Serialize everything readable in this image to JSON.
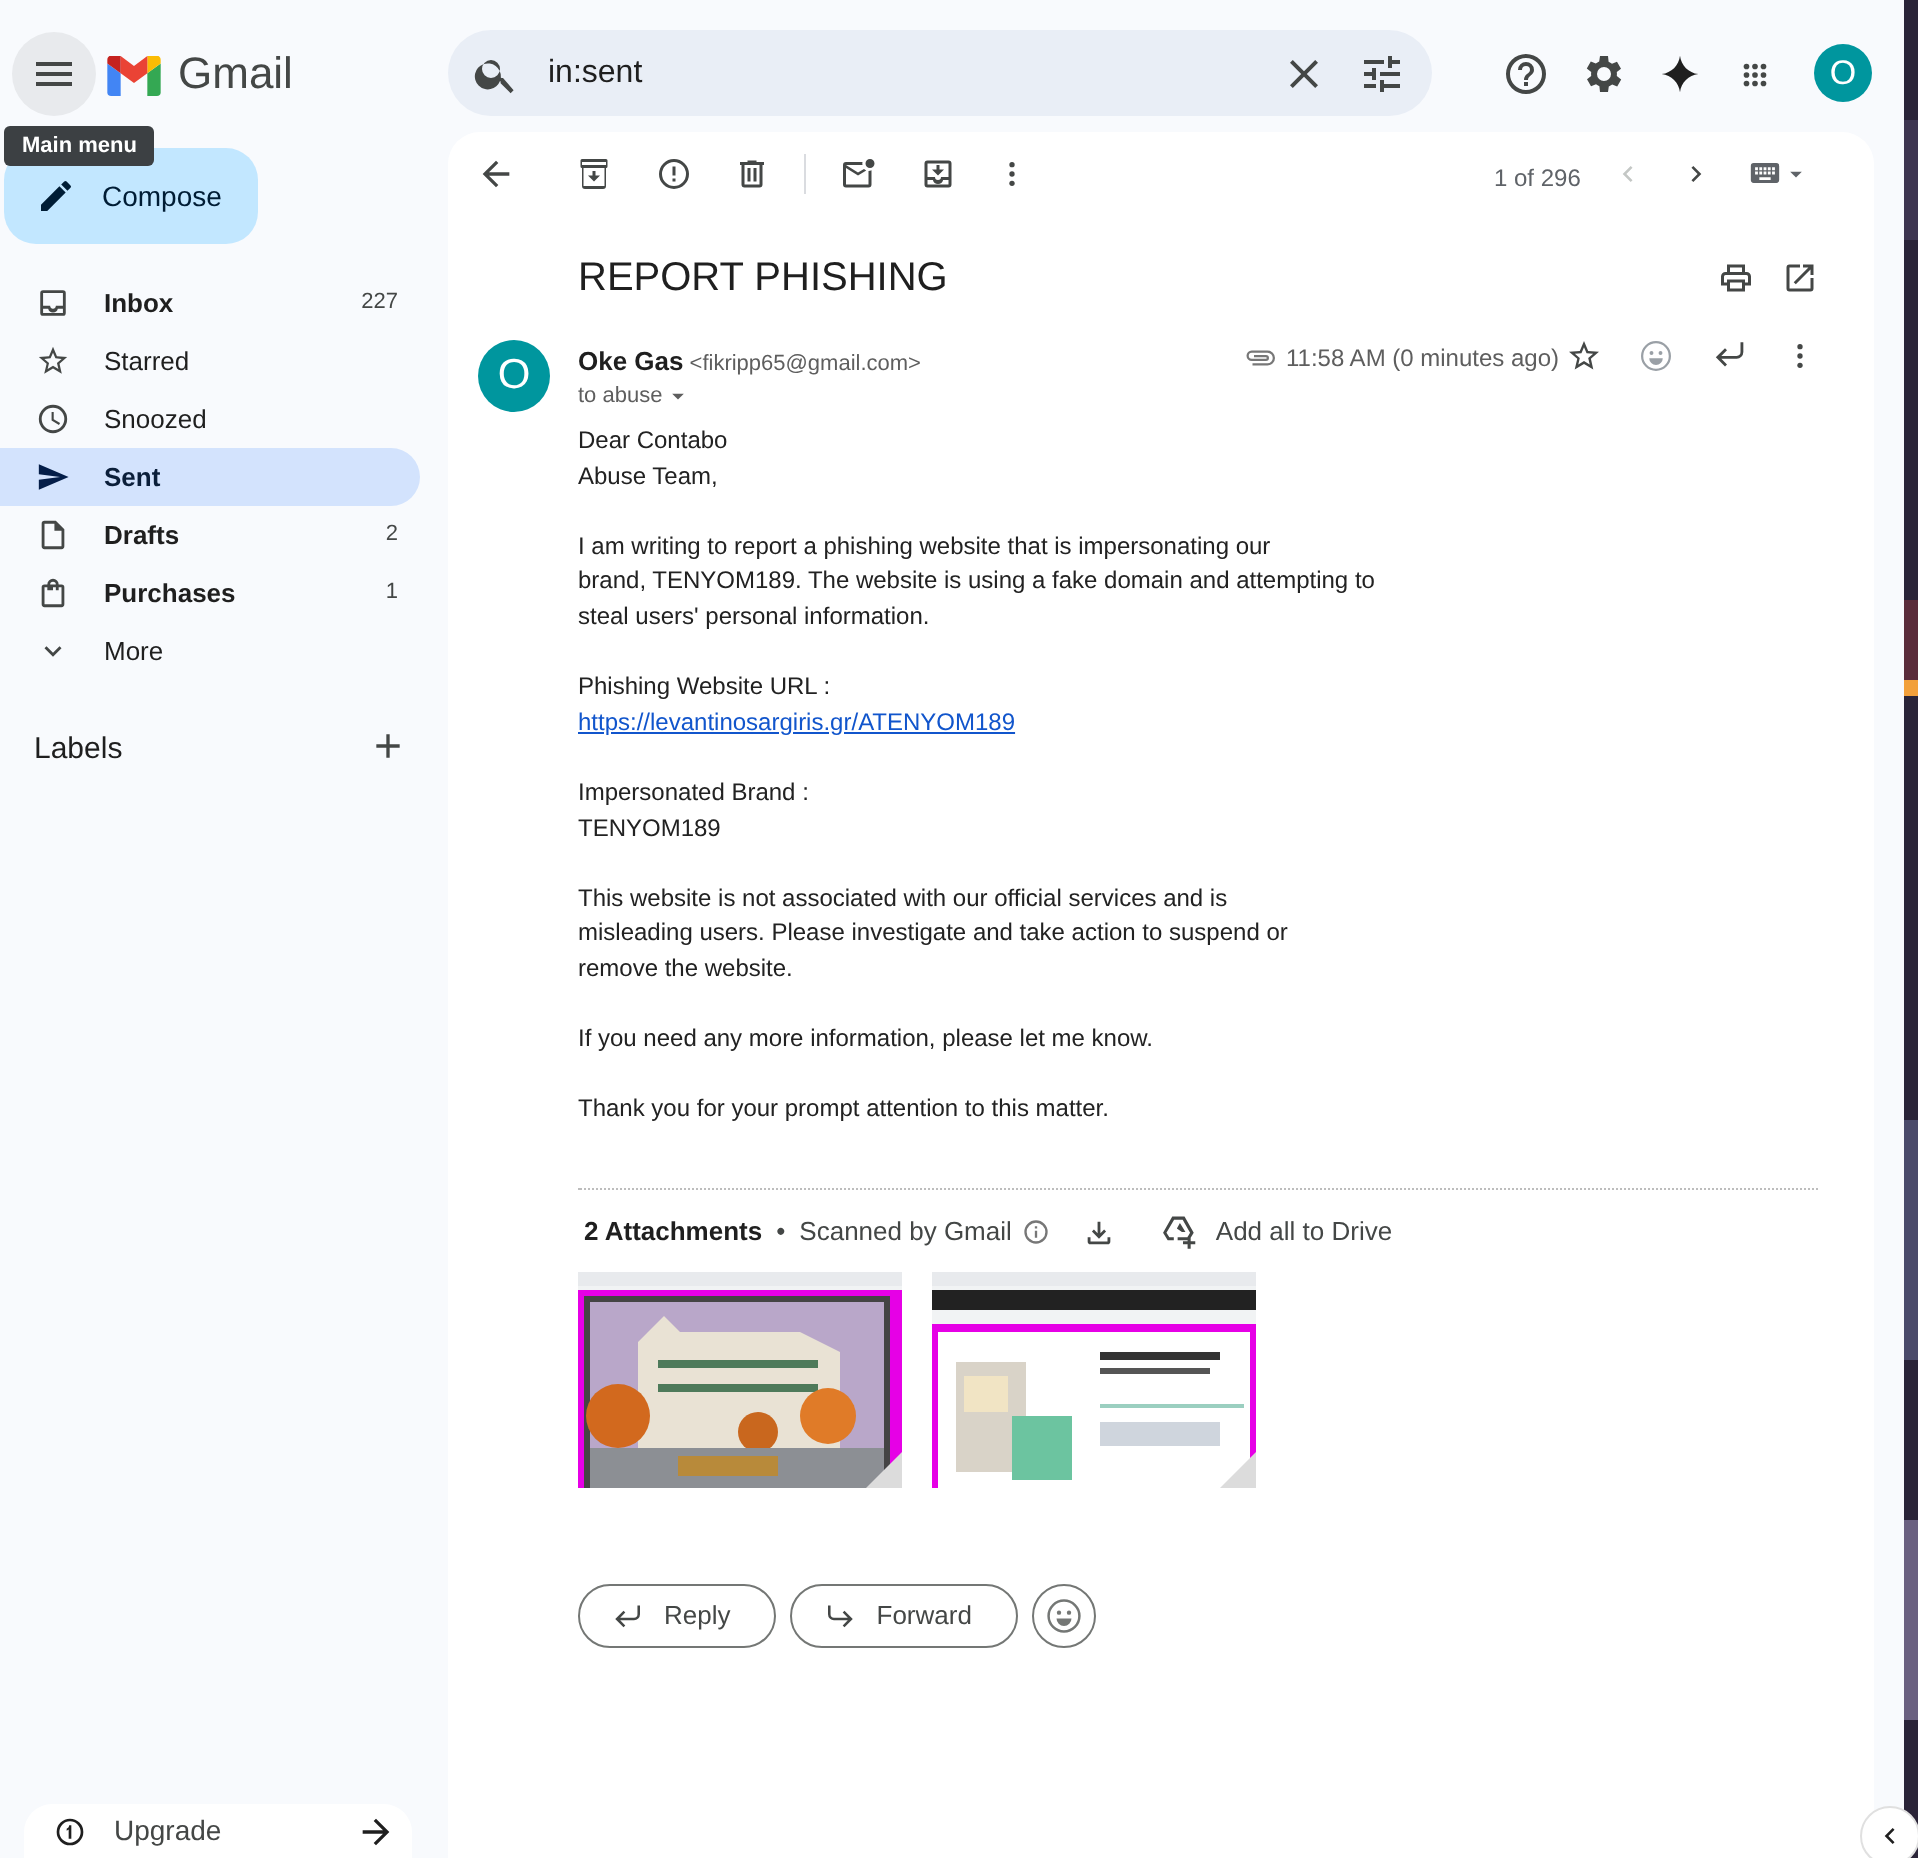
{
  "topbar": {
    "app_name": "Gmail",
    "tooltip": "Main menu",
    "search": {
      "value": "in:sent"
    },
    "avatar": "O"
  },
  "sidebar": {
    "compose": "Compose",
    "items": [
      {
        "label": "Inbox",
        "count": "227",
        "selected": false,
        "unread": true
      },
      {
        "label": "Starred",
        "selected": false,
        "unread": false
      },
      {
        "label": "Snoozed",
        "selected": false,
        "unread": false
      },
      {
        "label": "Sent",
        "selected": true,
        "unread": false
      },
      {
        "label": "Drafts",
        "count": "2",
        "selected": false,
        "unread": true
      },
      {
        "label": "Purchases",
        "count": "1",
        "selected": false,
        "unread": true
      },
      {
        "label": "More",
        "selected": false,
        "unread": false
      }
    ],
    "labels_heading": "Labels",
    "upgrade": "Upgrade"
  },
  "toolbar": {
    "position": "1 of 296",
    "prev_disabled": true
  },
  "email": {
    "subject": "REPORT PHISHING",
    "sender_name": "Oke Gas",
    "sender_email": "<fikripp65@gmail.com>",
    "avatar": "O",
    "recipient": "to abuse",
    "time": "11:58 AM (0 minutes ago)",
    "body": [
      {
        "lines": [
          {
            "kind": "text",
            "text": "Dear Contabo"
          },
          {
            "kind": "text",
            "text": "Abuse Team,"
          }
        ]
      },
      {
        "lines": [
          {
            "kind": "text",
            "text": "I am writing to report a phishing website that is impersonating our"
          },
          {
            "kind": "text",
            "text": "brand, TENYOM189. The website is using a fake domain and attempting to"
          },
          {
            "kind": "text",
            "text": "steal users' personal information."
          }
        ]
      },
      {
        "lines": [
          {
            "kind": "text",
            "text": "Phishing Website URL :"
          },
          {
            "kind": "link",
            "text": "https://levantinosargiris.gr/ATENYOM189"
          }
        ]
      },
      {
        "lines": [
          {
            "kind": "text",
            "text": "Impersonated Brand :"
          },
          {
            "kind": "text",
            "text": "TENYOM189"
          }
        ]
      },
      {
        "lines": [
          {
            "kind": "text",
            "text": "This website is not associated with our official services and is"
          },
          {
            "kind": "text",
            "text": "misleading users. Please investigate and take action to suspend or"
          },
          {
            "kind": "text",
            "text": "remove the website."
          }
        ]
      },
      {
        "lines": [
          {
            "kind": "text",
            "text": "If you need any more information, please let me know."
          }
        ]
      },
      {
        "lines": [
          {
            "kind": "text",
            "text": "Thank you for your prompt attention to this matter."
          }
        ]
      }
    ],
    "attachments": {
      "count_label": "2 Attachments",
      "separator": "•",
      "scan_label": "Scanned by Gmail",
      "drive_label": "Add all to Drive"
    },
    "actions": [
      {
        "kind": "reply",
        "label": "Reply"
      },
      {
        "kind": "forward",
        "label": "Forward"
      },
      {
        "kind": "emoji"
      }
    ]
  }
}
